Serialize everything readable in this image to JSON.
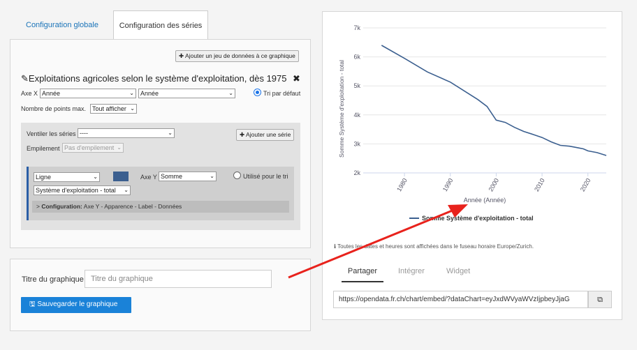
{
  "tabs": [
    {
      "label": "Configuration globale",
      "active": false
    },
    {
      "label": "Configuration des séries",
      "active": true
    }
  ],
  "left": {
    "add_dataset_label": "Ajouter un jeu de données à ce graphique",
    "dataset_title": "Exploitations agricoles selon le système d'exploitation, dès 1975",
    "axis_x_label": "Axe X",
    "axis_x_value1": "Année",
    "axis_x_value2": "Année",
    "sort_default_label": "Tri par défaut",
    "max_points_label": "Nombre de points max.",
    "max_points_value": "Tout afficher",
    "split_series_label": "Ventiler les séries",
    "split_series_value": "----",
    "add_series_label": "Ajouter une série",
    "stacking_label": "Empilement",
    "stacking_value": "Pas d'empilement",
    "series": {
      "type_value": "Ligne",
      "color": "#3b5f8f",
      "axis_y_label": "Axe Y",
      "axis_y_value": "Somme",
      "used_for_sort_label": "Utilisé pour le tri",
      "field_value": "Système d'exploitation - total",
      "config_prefix": ">",
      "config_label": "Configuration:",
      "config_items": "Axe Y - Apparence - Label - Données"
    }
  },
  "title_section": {
    "label": "Titre du graphique",
    "placeholder": "Titre du graphique",
    "save_label": "Sauvegarder le graphique"
  },
  "right": {
    "timezone_note": "Toutes les dates et heures sont affichées dans le fuseau horaire Europe/Zurich.",
    "share_tabs": [
      {
        "label": "Partager",
        "active": true
      },
      {
        "label": "Intégrer",
        "active": false
      },
      {
        "label": "Widget",
        "active": false
      }
    ],
    "url": "https://opendata.fr.ch/chart/embed/?dataChart=eyJxdWVyaWVzIjpbeyJjaG"
  },
  "chart_data": {
    "type": "line",
    "xlabel": "Année (Année)",
    "ylabel": "Somme Système d'exploitation - total",
    "xlim": [
      1971,
      2024
    ],
    "ylim": [
      2000,
      7000
    ],
    "y_ticks": [
      2000,
      3000,
      4000,
      5000,
      6000,
      7000
    ],
    "y_tick_labels": [
      "2k",
      "3k",
      "4k",
      "5k",
      "6k",
      "7k"
    ],
    "x_ticks": [
      1980,
      1990,
      2000,
      2010,
      2020
    ],
    "x_tick_labels": [
      "1980",
      "1990",
      "2000",
      "2010",
      "2020"
    ],
    "legend_position": "bottom",
    "series": [
      {
        "name": "Somme Système d'exploitation - total",
        "color": "#3b5f8f",
        "x": [
          1975,
          1980,
          1985,
          1990,
          1996,
          1998,
          2000,
          2002,
          2004,
          2006,
          2008,
          2010,
          2012,
          2014,
          2016,
          2018,
          2019,
          2020,
          2022,
          2024
        ],
        "y": [
          6400,
          5950,
          5480,
          5130,
          4530,
          4290,
          3820,
          3740,
          3570,
          3430,
          3330,
          3220,
          3070,
          2950,
          2920,
          2860,
          2830,
          2760,
          2700,
          2600
        ]
      }
    ]
  }
}
